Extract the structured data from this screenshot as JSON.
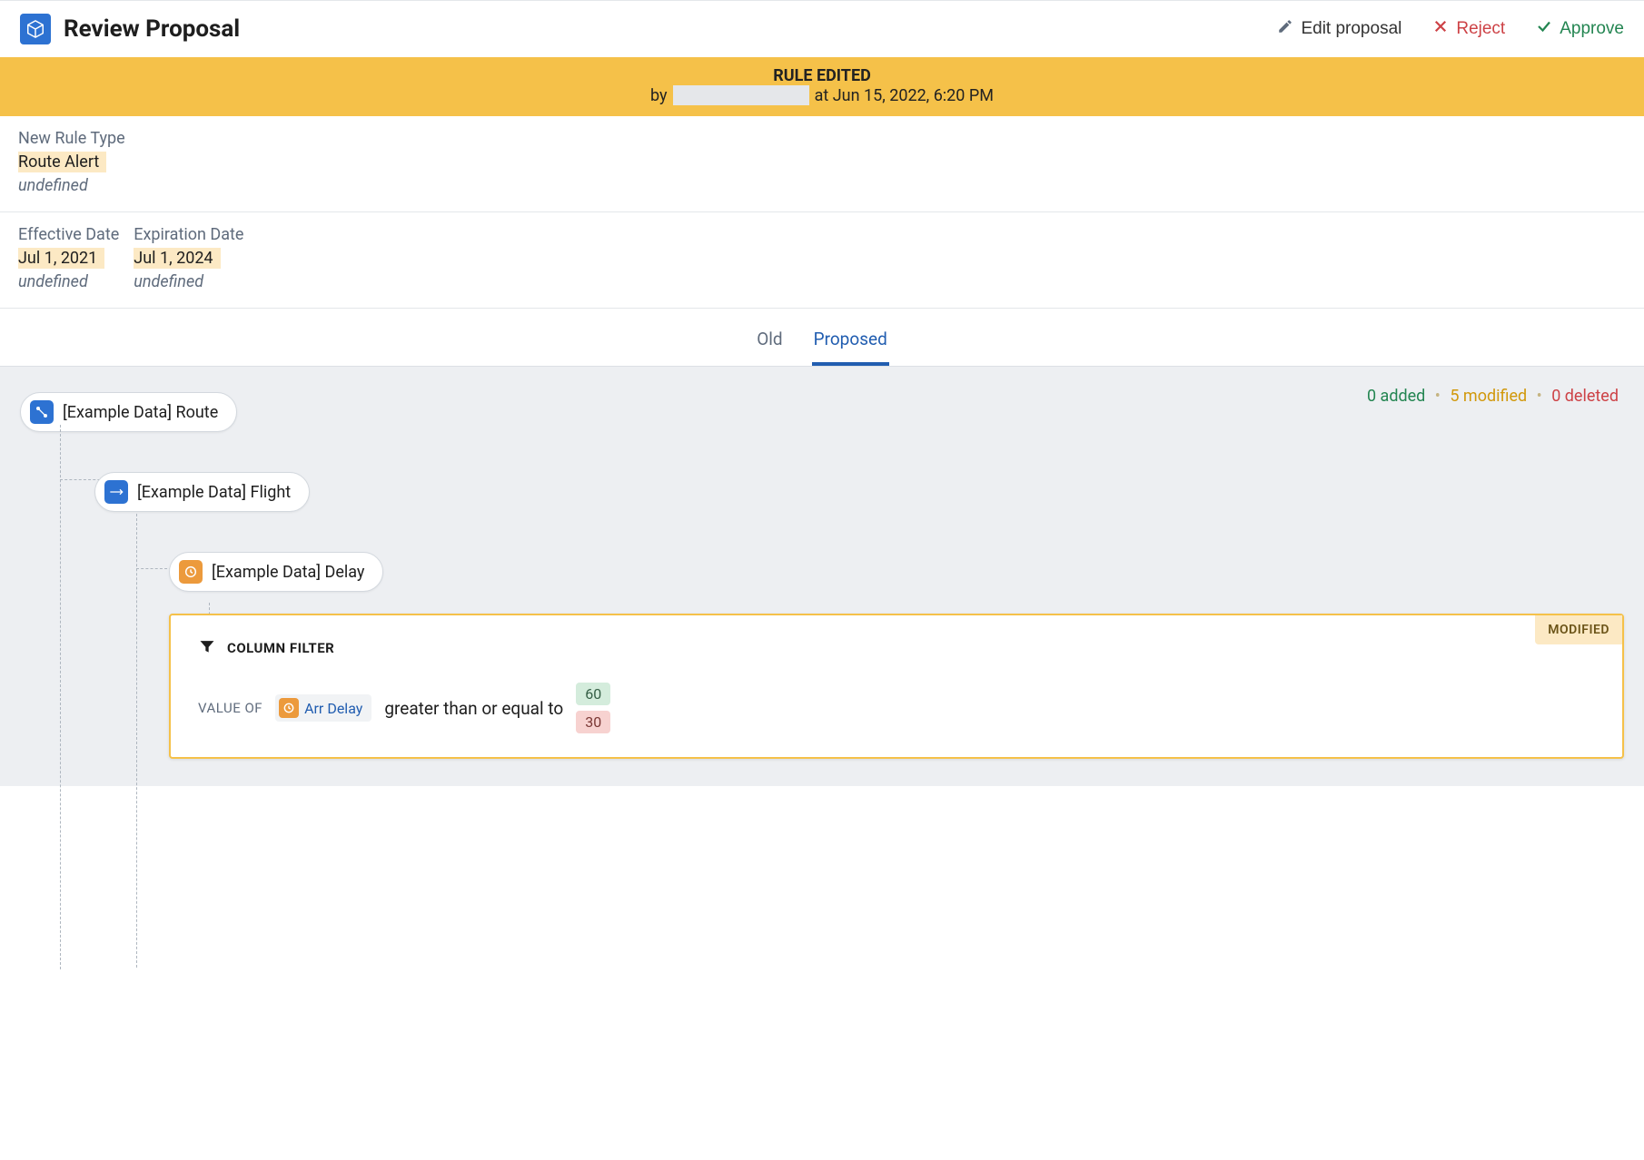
{
  "header": {
    "title": "Review Proposal",
    "edit_label": "Edit proposal",
    "reject_label": "Reject",
    "approve_label": "Approve"
  },
  "banner": {
    "title": "RULE EDITED",
    "by_prefix": "by",
    "at_text": "at Jun 15, 2022, 6:20 PM"
  },
  "rule_type": {
    "label": "New Rule Type",
    "value": "Route Alert",
    "prev": "undefined"
  },
  "dates": {
    "effective": {
      "label": "Effective Date",
      "value": "Jul 1, 2021",
      "prev": "undefined"
    },
    "expiration": {
      "label": "Expiration Date",
      "value": "Jul 1, 2024",
      "prev": "undefined"
    }
  },
  "tabs": {
    "old": "Old",
    "proposed": "Proposed"
  },
  "stats": {
    "added_label": "0 added",
    "modified_label": "5 modified",
    "deleted_label": "0 deleted"
  },
  "tree": {
    "route": "[Example Data] Route",
    "flight": "[Example Data] Flight",
    "delay": "[Example Data] Delay"
  },
  "filter": {
    "head": "COLUMN FILTER",
    "badge": "MODIFIED",
    "value_of": "VALUE OF",
    "column": "Arr Delay",
    "operator": "greater than or equal to",
    "old_value": "60",
    "new_value": "30"
  }
}
